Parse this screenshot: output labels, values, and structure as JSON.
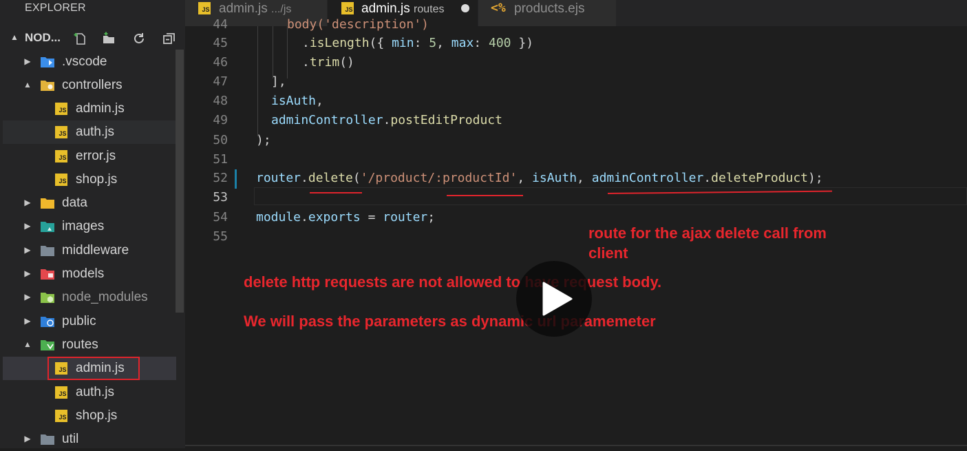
{
  "sidebar": {
    "title": "EXPLORER",
    "section_title": "NOD...",
    "tree": [
      {
        "label": ".vscode",
        "type": "folder",
        "expanded": false,
        "icon": "vscode-folder-icon",
        "color": "#3b8eea"
      },
      {
        "label": "controllers",
        "type": "folder",
        "expanded": true,
        "icon": "controllers-folder-icon",
        "color": "#e3b33a"
      },
      {
        "label": "admin.js",
        "type": "file",
        "icon": "js-icon"
      },
      {
        "label": "auth.js",
        "type": "file",
        "icon": "js-icon"
      },
      {
        "label": "error.js",
        "type": "file",
        "icon": "js-icon"
      },
      {
        "label": "shop.js",
        "type": "file",
        "icon": "js-icon"
      },
      {
        "label": "data",
        "type": "folder",
        "expanded": false,
        "icon": "data-folder-icon",
        "color": "#f0b82c"
      },
      {
        "label": "images",
        "type": "folder",
        "expanded": false,
        "icon": "images-folder-icon",
        "color": "#27a29a"
      },
      {
        "label": "middleware",
        "type": "folder",
        "expanded": false,
        "icon": "middleware-folder-icon",
        "color": "#7e8a96"
      },
      {
        "label": "models",
        "type": "folder",
        "expanded": false,
        "icon": "models-folder-icon",
        "color": "#e5484d"
      },
      {
        "label": "node_modules",
        "type": "folder",
        "expanded": false,
        "icon": "node-modules-folder-icon",
        "color": "#8bc34a"
      },
      {
        "label": "public",
        "type": "folder",
        "expanded": false,
        "icon": "public-folder-icon",
        "color": "#2f7fd9"
      },
      {
        "label": "routes",
        "type": "folder",
        "expanded": true,
        "icon": "routes-folder-icon",
        "color": "#4caf50"
      },
      {
        "label": "admin.js",
        "type": "file",
        "icon": "js-icon"
      },
      {
        "label": "auth.js",
        "type": "file",
        "icon": "js-icon"
      },
      {
        "label": "shop.js",
        "type": "file",
        "icon": "js-icon"
      },
      {
        "label": "util",
        "type": "folder",
        "expanded": false,
        "icon": "util-folder-icon",
        "color": "#7e8a96"
      }
    ],
    "toolbar_icons": [
      "new-file-icon",
      "new-folder-icon",
      "refresh-icon",
      "collapse-all-icon"
    ]
  },
  "tabs": [
    {
      "label": "admin.js",
      "desc": ".../js",
      "active": false,
      "icon": "js-icon"
    },
    {
      "label": "admin.js",
      "desc": "routes",
      "active": true,
      "dirty": true,
      "icon": "js-icon"
    },
    {
      "label": "products.ejs",
      "desc": "",
      "active": false,
      "icon": "ejs-icon"
    }
  ],
  "editor": {
    "partial_line": "body('description')",
    "lines": [
      {
        "num": "45",
        "text": ".isLength({ min: 5, max: 400 })"
      },
      {
        "num": "46",
        "text": ".trim()"
      },
      {
        "num": "47",
        "text": "],"
      },
      {
        "num": "48",
        "text": "isAuth,"
      },
      {
        "num": "49",
        "text": "adminController.postEditProduct"
      },
      {
        "num": "50",
        "text": ");"
      },
      {
        "num": "51",
        "text": ""
      },
      {
        "num": "52",
        "text": "router.delete('/product/:productId', isAuth, adminController.deleteProduct);"
      },
      {
        "num": "53",
        "text": ""
      },
      {
        "num": "54",
        "text": "module.exports = router;"
      },
      {
        "num": "55",
        "text": ""
      }
    ],
    "partial_line_number": "44"
  },
  "annotations": {
    "route_note": "route for the ajax delete call from\nclient",
    "body_note": "delete http requests are not allowed to have request body.",
    "params_note": "We will pass the parameters as dynamic url paramemeter",
    "color": "#e8262d"
  },
  "video": {
    "overlay": "play-icon"
  }
}
